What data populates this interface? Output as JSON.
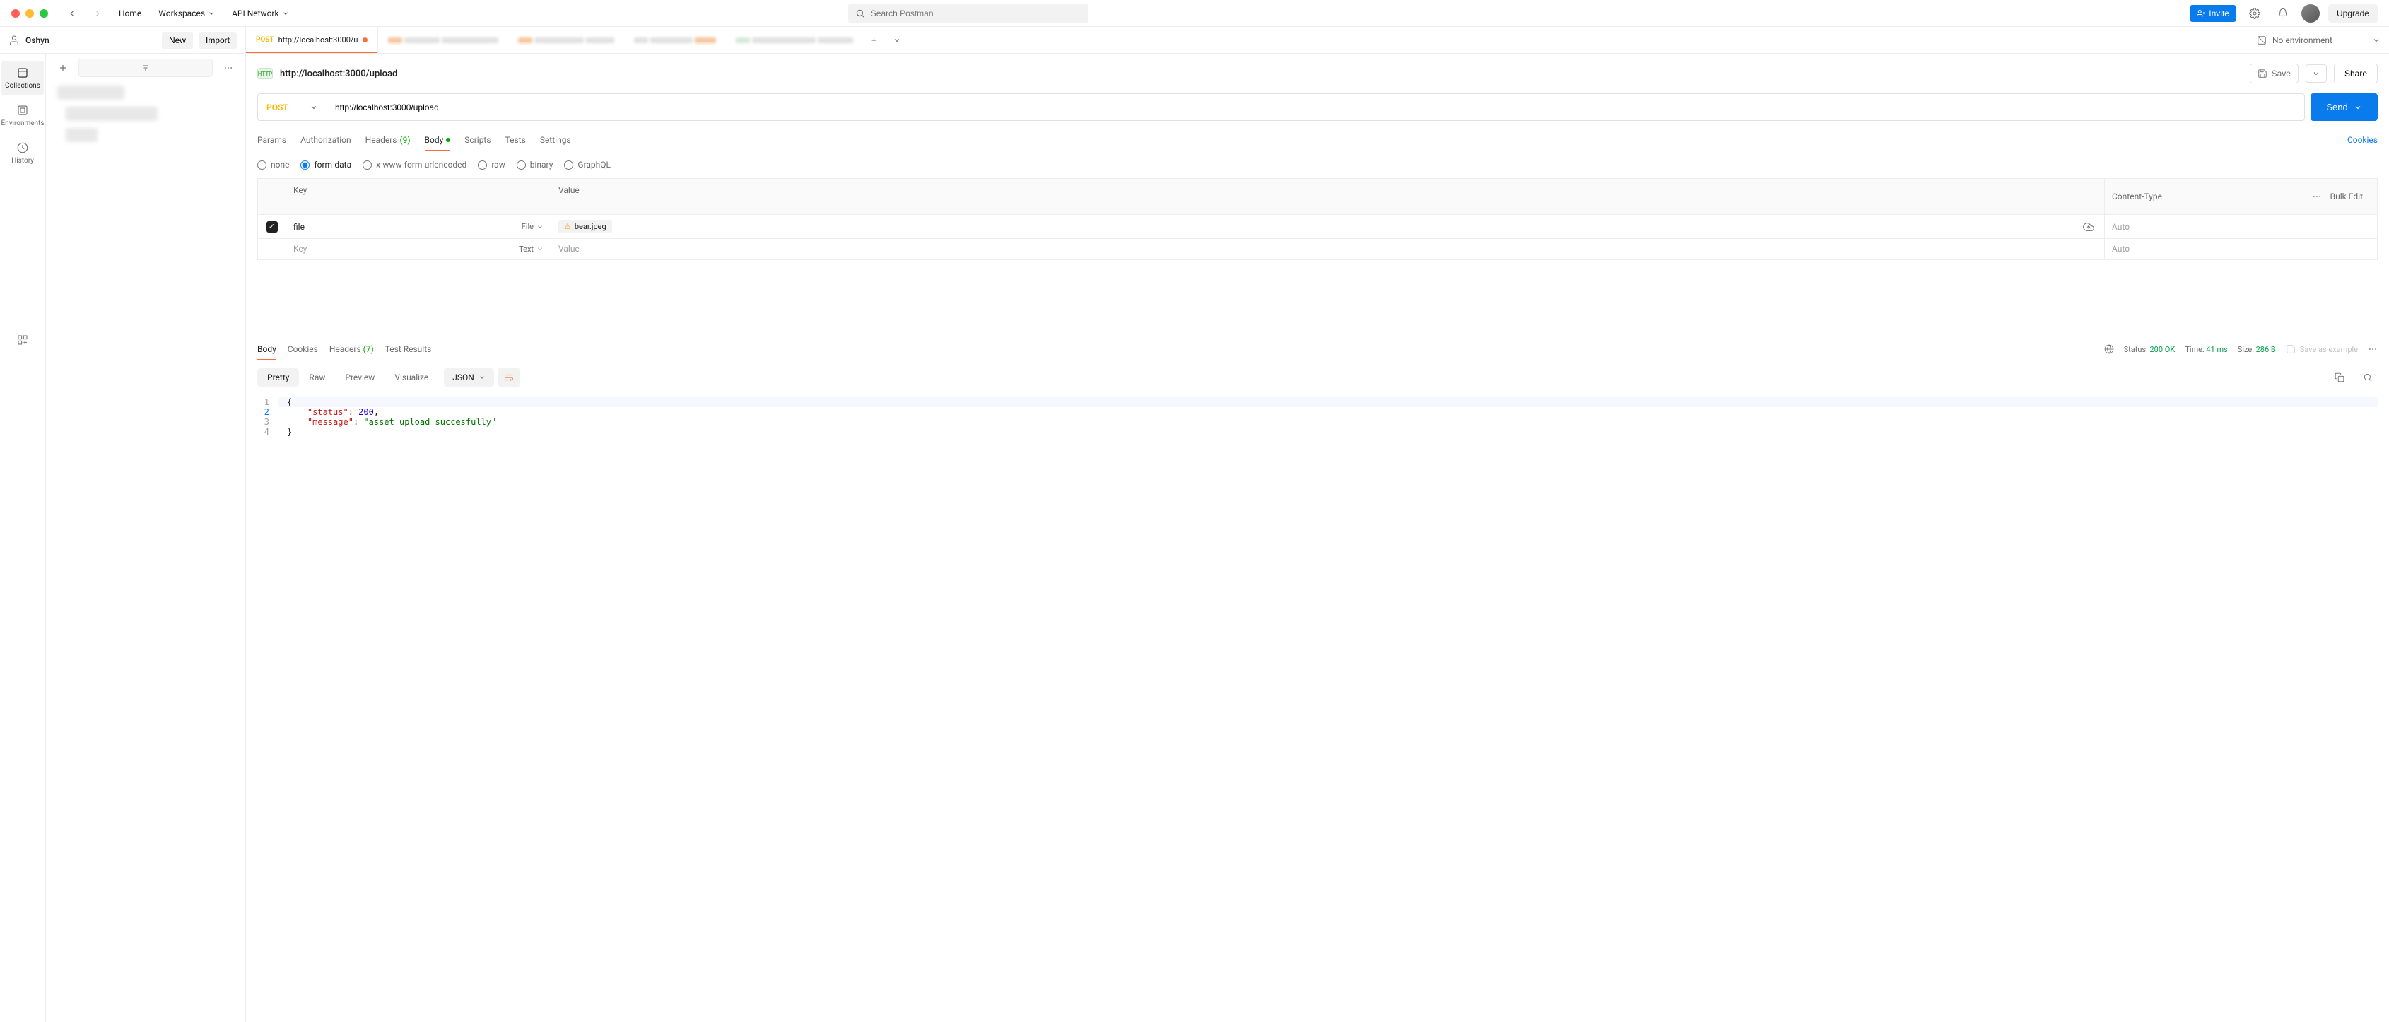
{
  "titlebar": {
    "home": "Home",
    "workspaces": "Workspaces",
    "api_network": "API Network",
    "search_placeholder": "Search Postman",
    "invite": "Invite",
    "upgrade": "Upgrade"
  },
  "workspace": {
    "name": "Oshyn",
    "new_btn": "New",
    "import_btn": "Import"
  },
  "active_tab": {
    "method": "POST",
    "url_short": "http://localhost:3000/u"
  },
  "env": {
    "label": "No environment"
  },
  "rail": {
    "collections": "Collections",
    "environments": "Environments",
    "history": "History"
  },
  "request": {
    "title": "http://localhost:3000/upload",
    "save": "Save",
    "share": "Share",
    "method": "POST",
    "url": "http://localhost:3000/upload",
    "send": "Send"
  },
  "req_tabs": {
    "params": "Params",
    "authorization": "Authorization",
    "headers": "Headers",
    "headers_count": "(9)",
    "body": "Body",
    "scripts": "Scripts",
    "tests": "Tests",
    "settings": "Settings",
    "cookies": "Cookies"
  },
  "body_types": {
    "none": "none",
    "form_data": "form-data",
    "urlencoded": "x-www-form-urlencoded",
    "raw": "raw",
    "binary": "binary",
    "graphql": "GraphQL"
  },
  "form_table": {
    "head": {
      "key": "Key",
      "value": "Value",
      "content_type": "Content-Type"
    },
    "actions": {
      "bulk_edit": "Bulk Edit"
    },
    "row1": {
      "key": "file",
      "type": "File",
      "filename": "bear.jpeg",
      "ct": "Auto"
    },
    "placeholder": {
      "key": "Key",
      "type": "Text",
      "value": "Value",
      "ct": "Auto"
    }
  },
  "response": {
    "tabs": {
      "body": "Body",
      "cookies": "Cookies",
      "headers": "Headers",
      "headers_count": "(7)",
      "test_results": "Test Results"
    },
    "meta": {
      "status_label": "Status:",
      "status_value": "200 OK",
      "time_label": "Time:",
      "time_value": "41 ms",
      "size_label": "Size:",
      "size_value": "286 B",
      "save_as_example": "Save as example"
    },
    "view": {
      "pretty": "Pretty",
      "raw": "Raw",
      "preview": "Preview",
      "visualize": "Visualize",
      "format": "JSON"
    },
    "json": {
      "l1": "{",
      "l2_key": "\"status\"",
      "l2_val": "200",
      "l3_key": "\"message\"",
      "l3_val": "\"asset upload succesfully\"",
      "l4": "}"
    }
  }
}
